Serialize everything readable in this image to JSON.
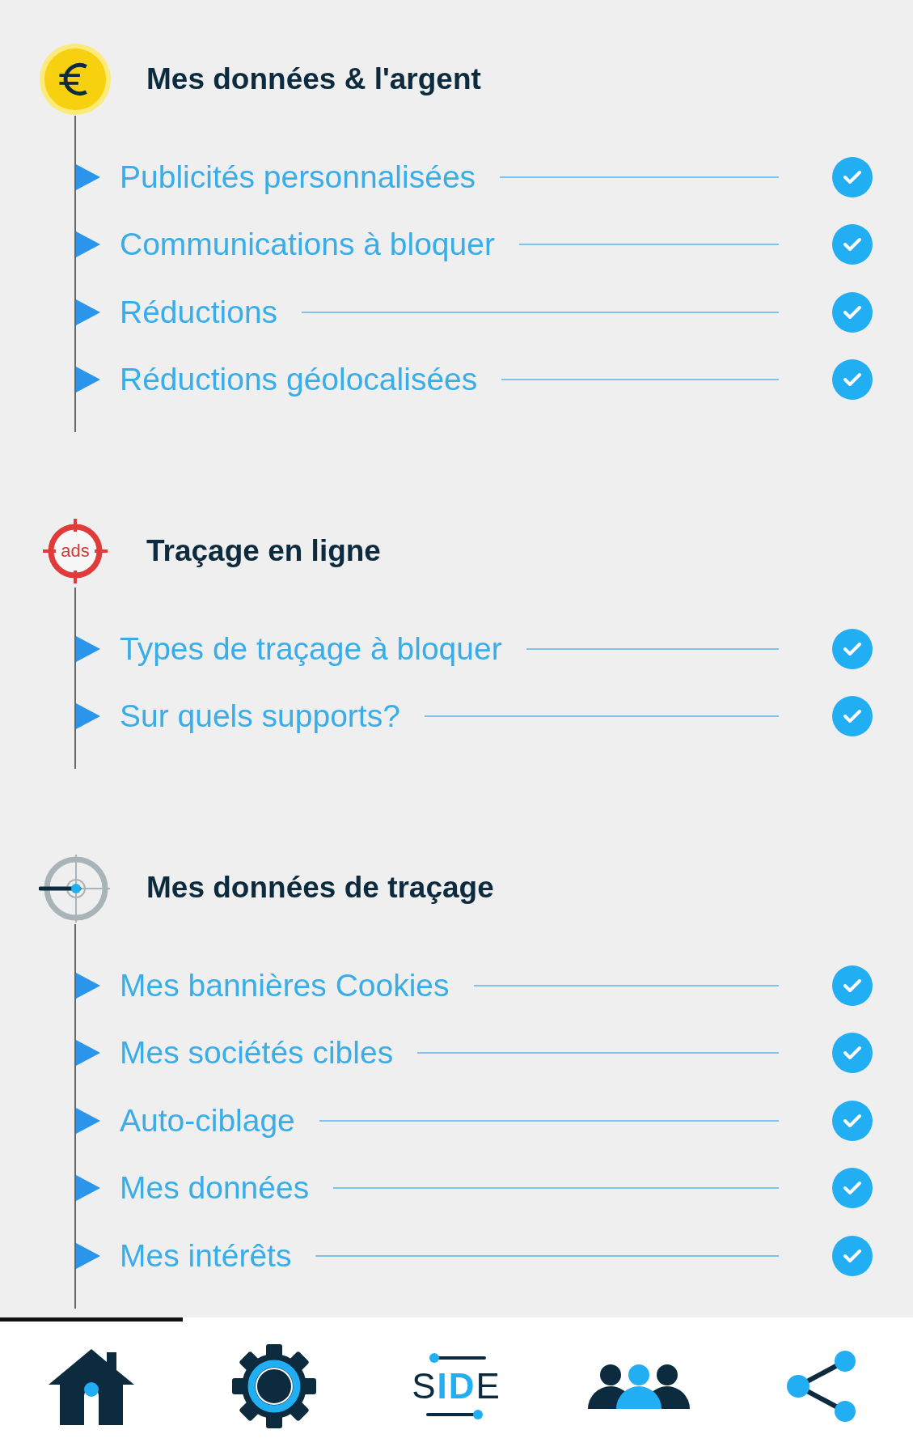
{
  "sections": [
    {
      "icon": {
        "kind": "coin"
      },
      "title": "Mes données & l'argent",
      "items": [
        {
          "label": "Publicités personnalisées",
          "checked": true
        },
        {
          "label": "Communications à bloquer",
          "checked": true
        },
        {
          "label": "Réductions",
          "checked": true
        },
        {
          "label": "Réductions géolocalisées",
          "checked": true
        }
      ]
    },
    {
      "icon": {
        "kind": "ads",
        "text": "ads"
      },
      "title": "Traçage en ligne",
      "items": [
        {
          "label": "Types de traçage à bloquer",
          "checked": true
        },
        {
          "label": "Sur quels supports?",
          "checked": true
        }
      ]
    },
    {
      "icon": {
        "kind": "target"
      },
      "title": "Mes données de traçage",
      "items": [
        {
          "label": "Mes bannières Cookies",
          "checked": true
        },
        {
          "label": "Mes sociétés cibles",
          "checked": true
        },
        {
          "label": "Auto-ciblage",
          "checked": true
        },
        {
          "label": "Mes données",
          "checked": true
        },
        {
          "label": "Mes intérêts",
          "checked": true
        }
      ]
    }
  ],
  "nav": [
    {
      "kind": "home",
      "selected": true
    },
    {
      "kind": "settings",
      "selected": false
    },
    {
      "kind": "logo",
      "parts": [
        "S",
        "ID",
        "E"
      ],
      "selected": false
    },
    {
      "kind": "people",
      "selected": false
    },
    {
      "kind": "share",
      "selected": false
    }
  ]
}
